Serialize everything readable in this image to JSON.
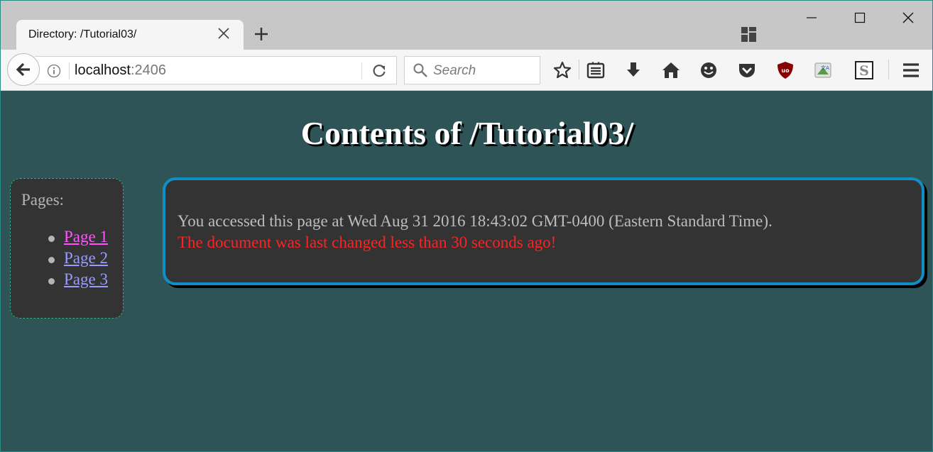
{
  "browser": {
    "tab_title": "Directory: /Tutorial03/",
    "url_host": "localhost",
    "url_port": ":2406",
    "search_placeholder": "Search"
  },
  "page": {
    "title": "Contents of /Tutorial03/",
    "sidebar_label": "Pages:",
    "pages": [
      {
        "label": "Page 1",
        "color": "#ff55ff"
      },
      {
        "label": "Page 2",
        "color": "#9a9aff"
      },
      {
        "label": "Page 3",
        "color": "#9a9aff"
      }
    ],
    "accessed_text": "You accessed this page at Wed Aug 31 2016 18:43:02 GMT-0400 (Eastern Standard Time).",
    "changed_text": "The document was last changed less than 30 seconds ago!"
  },
  "colors": {
    "page_background": "#2f5457",
    "box_background": "#333333",
    "main_border": "#0f8fc4",
    "sidebar_border": "#2fae8a",
    "changed_text": "#ff2222"
  },
  "icons": [
    "close-icon",
    "plus-icon",
    "tiles-icon",
    "minimize-icon",
    "maximize-icon",
    "window-close-icon",
    "back-arrow-icon",
    "info-icon",
    "reload-icon",
    "search-icon",
    "bookmark-star-icon",
    "reading-list-icon",
    "download-icon",
    "home-icon",
    "emoji-icon",
    "pocket-icon",
    "ublock-icon",
    "translate-icon",
    "s-extension-icon",
    "hamburger-menu-icon"
  ]
}
